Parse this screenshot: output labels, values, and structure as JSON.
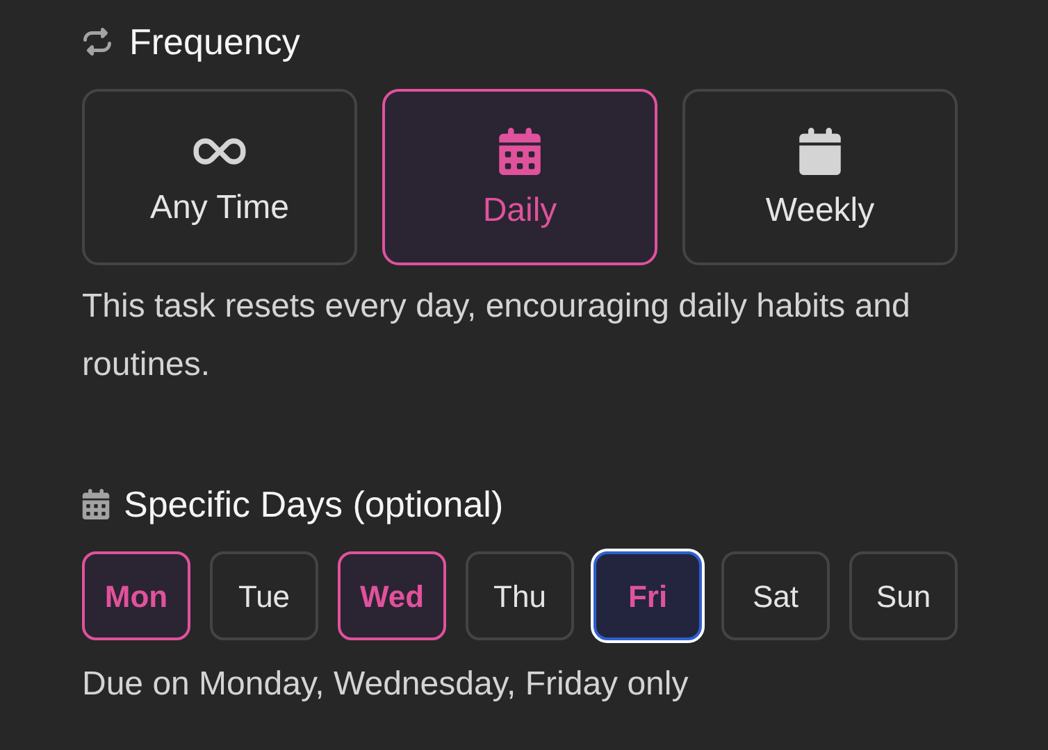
{
  "frequency": {
    "title": "Frequency",
    "options": [
      {
        "label": "Any Time",
        "kind": "infinity",
        "selected": false
      },
      {
        "label": "Daily",
        "kind": "calendar-days",
        "selected": true
      },
      {
        "label": "Weekly",
        "kind": "calendar",
        "selected": false
      }
    ],
    "description": "This task resets every day, encouraging daily habits and routines."
  },
  "specific_days": {
    "title": "Specific Days (optional)",
    "days": [
      {
        "label": "Mon",
        "selected": true,
        "focused": false
      },
      {
        "label": "Tue",
        "selected": false,
        "focused": false
      },
      {
        "label": "Wed",
        "selected": true,
        "focused": false
      },
      {
        "label": "Thu",
        "selected": false,
        "focused": false
      },
      {
        "label": "Fri",
        "selected": true,
        "focused": true
      },
      {
        "label": "Sat",
        "selected": false,
        "focused": false
      },
      {
        "label": "Sun",
        "selected": false,
        "focused": false
      }
    ],
    "summary": "Due on Monday, Wednesday, Friday only"
  }
}
